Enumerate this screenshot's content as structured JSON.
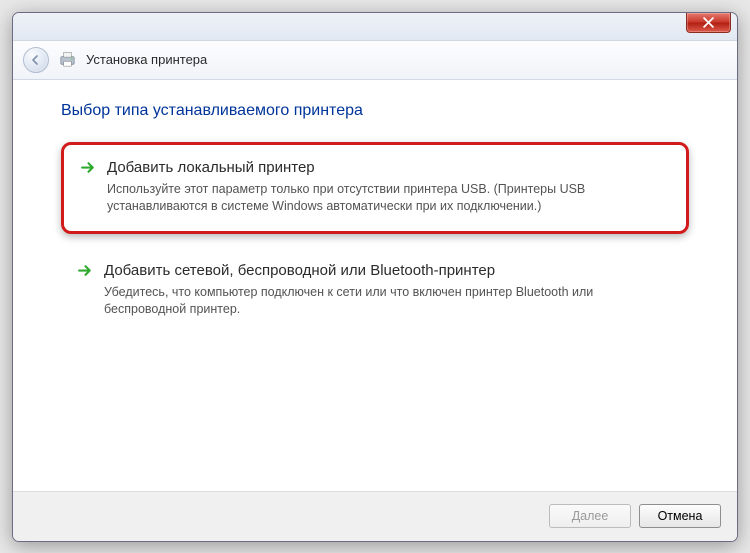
{
  "header": {
    "title": "Установка принтера"
  },
  "main": {
    "heading": "Выбор типа устанавливаемого принтера",
    "options": [
      {
        "title": "Добавить локальный принтер",
        "desc": "Используйте этот параметр только при отсутствии принтера USB. (Принтеры USB устанавливаются в системе Windows автоматически при их подключении.)"
      },
      {
        "title": "Добавить сетевой, беспроводной или Bluetooth-принтер",
        "desc": "Убедитесь, что компьютер подключен к сети или что включен принтер Bluetooth или беспроводной принтер."
      }
    ]
  },
  "footer": {
    "next": "Далее",
    "cancel": "Отмена"
  }
}
